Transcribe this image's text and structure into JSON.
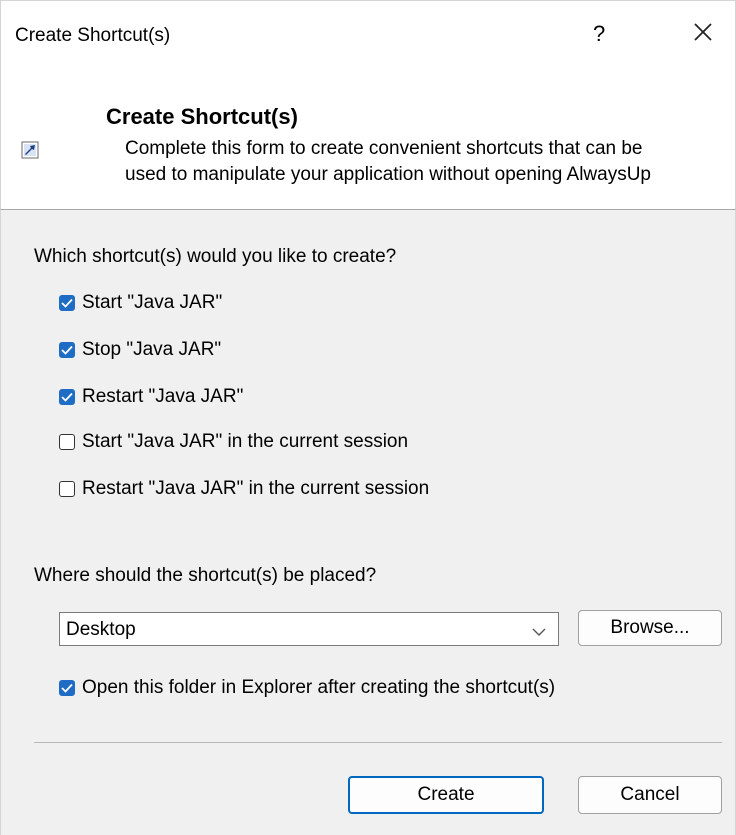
{
  "window": {
    "title": "Create Shortcut(s)",
    "help_label": "?"
  },
  "header": {
    "title": "Create Shortcut(s)",
    "description_line1": "Complete this form to create convenient shortcuts that can be",
    "description_line2": "used to manipulate your application without opening AlwaysUp"
  },
  "shortcuts": {
    "question": "Which shortcut(s) would you like to create?",
    "options": [
      {
        "label": "Start \"Java JAR\"",
        "checked": true
      },
      {
        "label": "Stop \"Java JAR\"",
        "checked": true
      },
      {
        "label": "Restart \"Java JAR\"",
        "checked": true
      },
      {
        "label": "Start \"Java JAR\" in the current session",
        "checked": false
      },
      {
        "label": "Restart \"Java JAR\" in the current session",
        "checked": false
      }
    ]
  },
  "placement": {
    "question": "Where should the shortcut(s) be placed?",
    "location_value": "Desktop",
    "browse_label": "Browse...",
    "open_folder_label": "Open this folder in Explorer after creating the shortcut(s)",
    "open_folder_checked": true
  },
  "footer": {
    "create_label": "Create",
    "cancel_label": "Cancel"
  },
  "colors": {
    "accent": "#1f6cc5",
    "default_button_border": "#0067c0"
  }
}
